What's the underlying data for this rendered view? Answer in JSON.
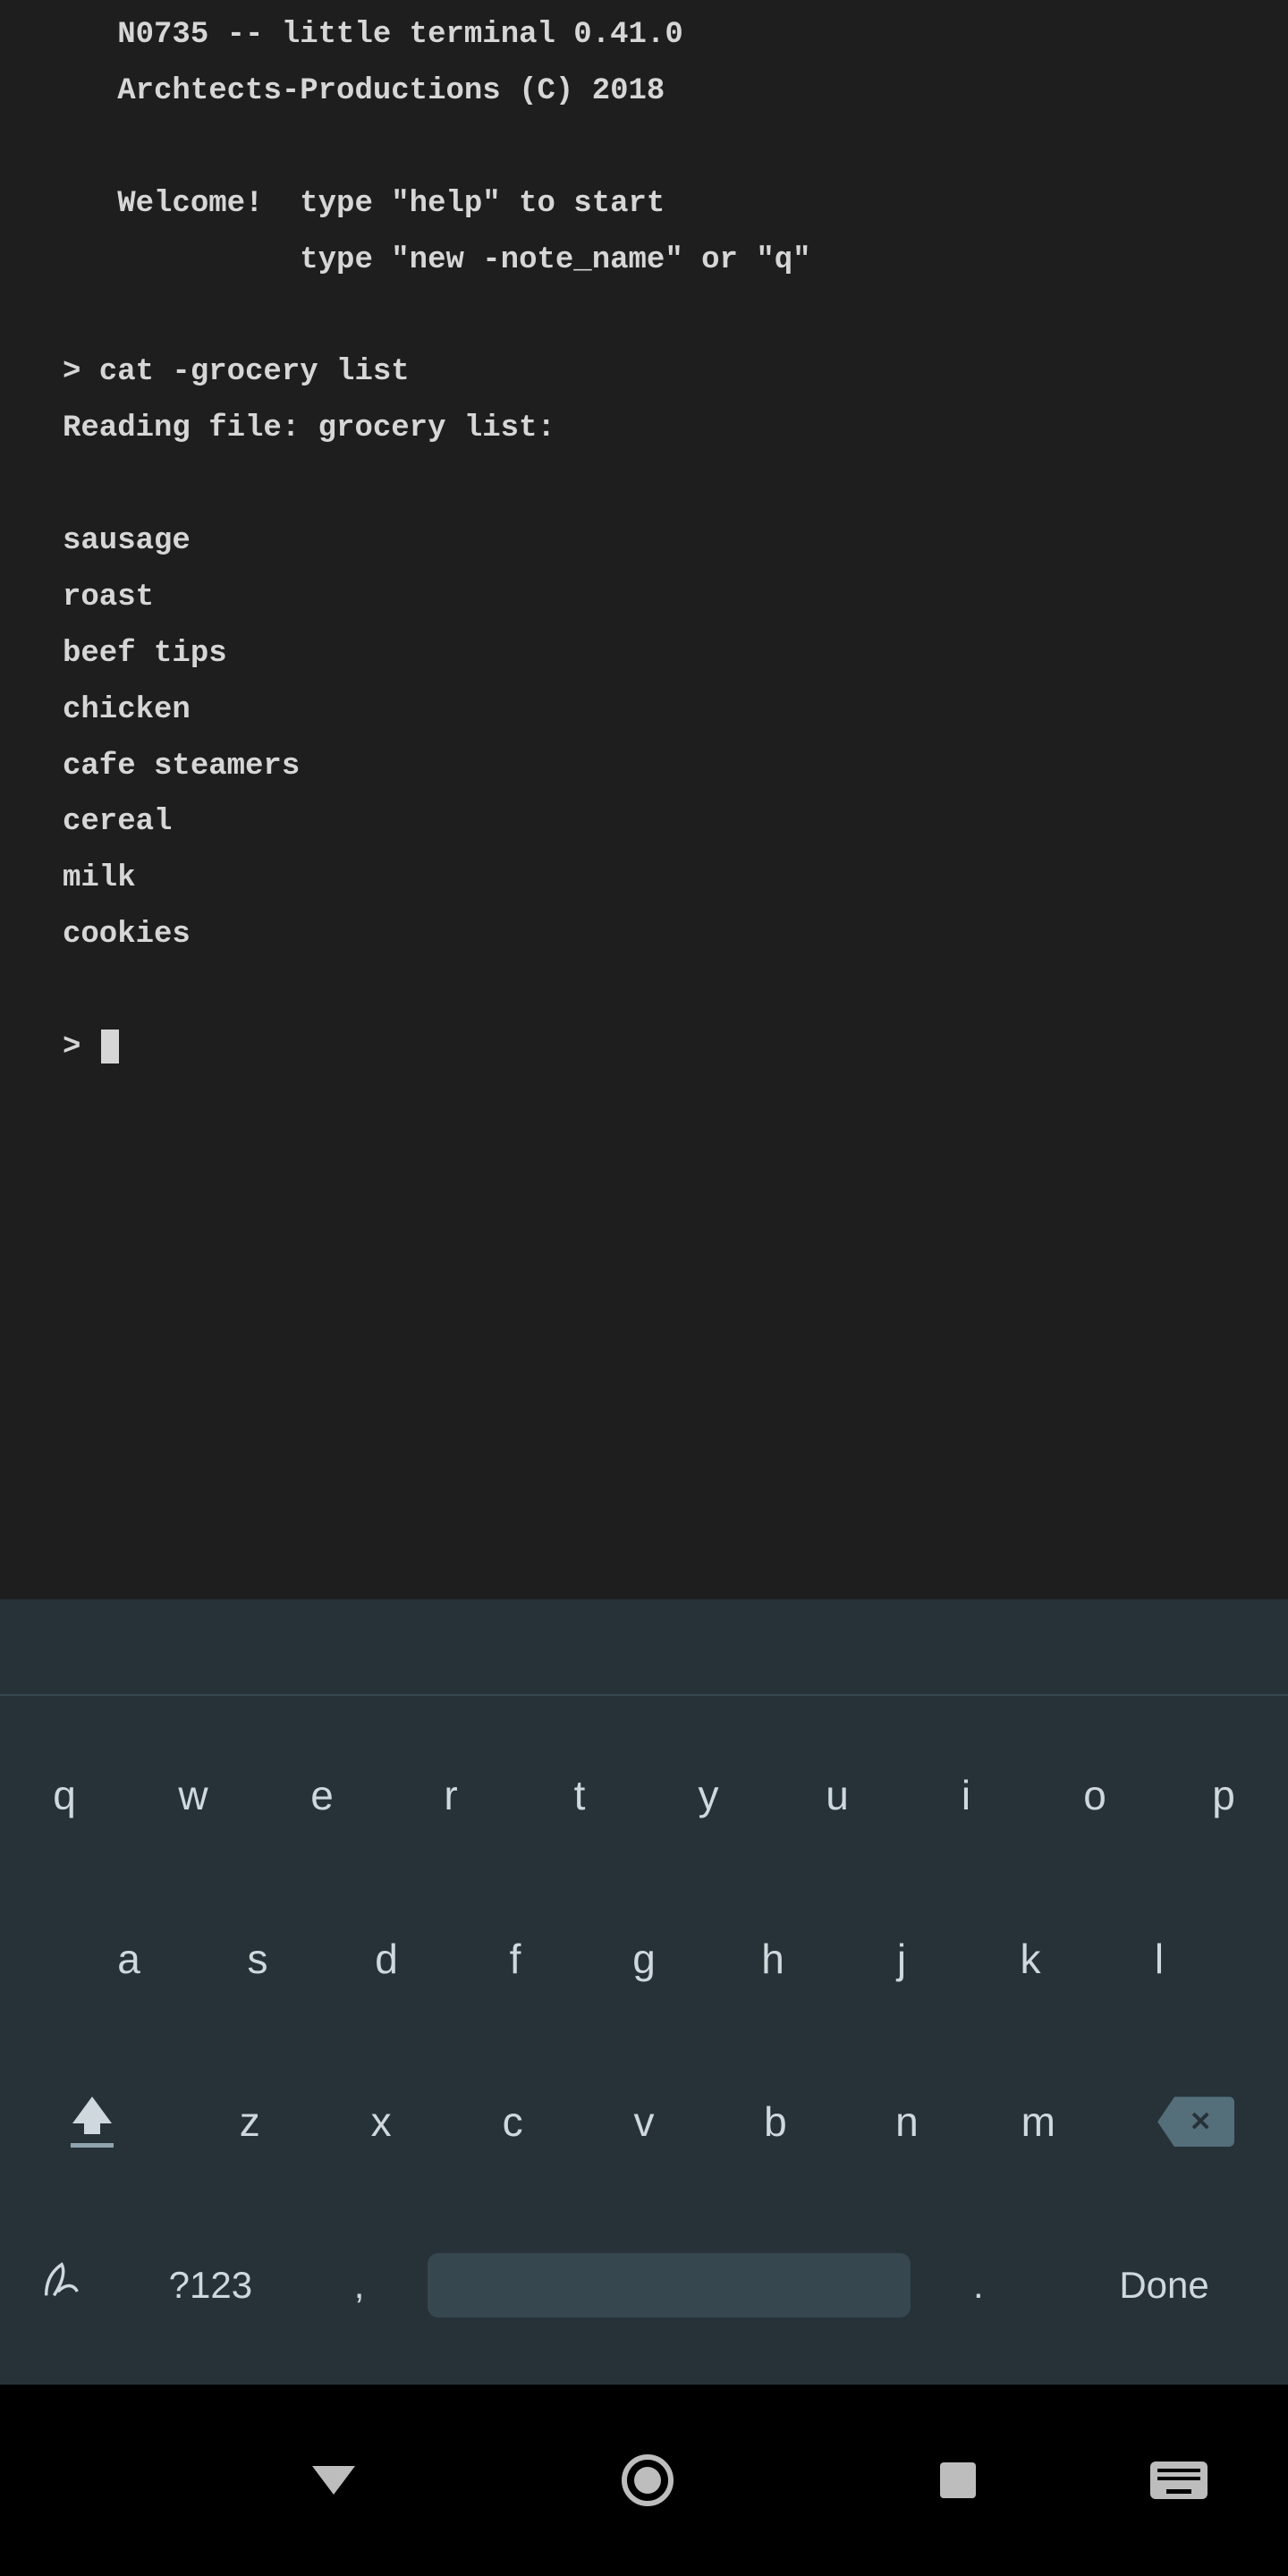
{
  "terminal": {
    "header_line1": "   N0735 -- little terminal 0.41.0",
    "header_line2": "   Archtects-Productions (C) 2018",
    "welcome_line1": "   Welcome!  type \"help\" to start",
    "welcome_line2": "             type \"new -note_name\" or \"q\"",
    "prompt_cmd": "> cat -grocery list",
    "reading": "Reading file: grocery list:",
    "items": [
      "sausage",
      "roast",
      "beef tips",
      "chicken",
      "cafe steamers",
      "cereal",
      "milk",
      "cookies"
    ],
    "prompt_empty": "> "
  },
  "keyboard": {
    "row1": [
      "q",
      "w",
      "e",
      "r",
      "t",
      "y",
      "u",
      "i",
      "o",
      "p"
    ],
    "row2": [
      "a",
      "s",
      "d",
      "f",
      "g",
      "h",
      "j",
      "k",
      "l"
    ],
    "row3": [
      "z",
      "x",
      "c",
      "v",
      "b",
      "n",
      "m"
    ],
    "symbols_key": "?123",
    "comma_key": ",",
    "period_key": ".",
    "done_key": "Done"
  }
}
